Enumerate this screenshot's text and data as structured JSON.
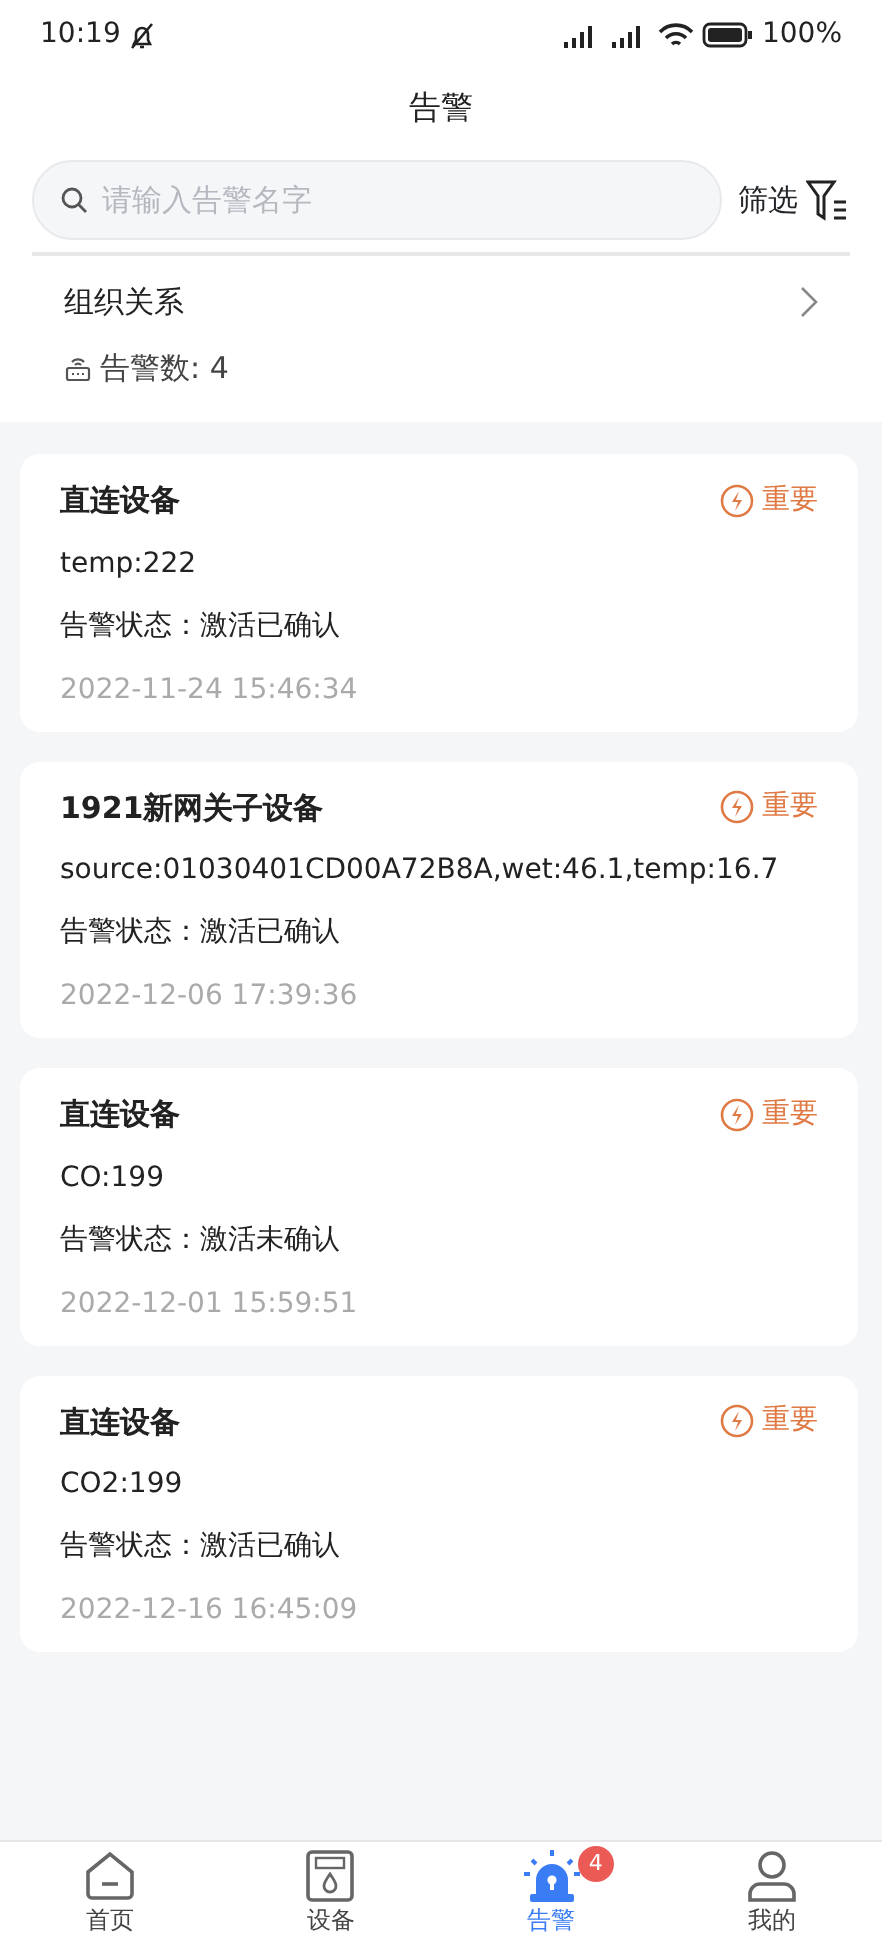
{
  "status_bar": {
    "time": "10:19",
    "battery": "100%"
  },
  "title": "告警",
  "search": {
    "placeholder": "请输入告警名字"
  },
  "filter": {
    "label": "筛选"
  },
  "org": {
    "label": "组织关系"
  },
  "count": {
    "label": "告警数:",
    "value": "4"
  },
  "alarms": [
    {
      "device": "直连设备",
      "level": "重要",
      "detail": "temp:222",
      "status": "告警状态：激活已确认",
      "time": "2022-11-24 15:46:34"
    },
    {
      "device": "1921新网关子设备",
      "level": "重要",
      "detail": "source:01030401CD00A72B8A,wet:46.1,temp:16.7",
      "status": "告警状态：激活已确认",
      "time": "2022-12-06 17:39:36"
    },
    {
      "device": "直连设备",
      "level": "重要",
      "detail": "CO:199",
      "status": "告警状态：激活未确认",
      "time": "2022-12-01 15:59:51"
    },
    {
      "device": "直连设备",
      "level": "重要",
      "detail": "CO2:199",
      "status": "告警状态：激活已确认",
      "time": "2022-12-16 16:45:09"
    }
  ],
  "nav": [
    {
      "kind": "home",
      "label": "首页",
      "selected": false
    },
    {
      "kind": "device",
      "label": "设备",
      "selected": false
    },
    {
      "kind": "alarm",
      "label": "告警",
      "selected": true,
      "badge": "4"
    },
    {
      "kind": "me",
      "label": "我的",
      "selected": false
    }
  ]
}
